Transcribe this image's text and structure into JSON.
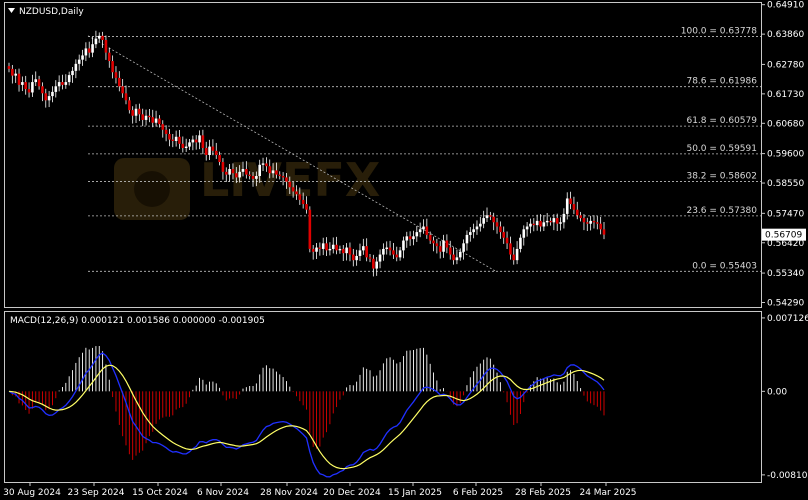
{
  "chart_data": [
    {
      "type": "candlestick",
      "symbol_label": "NZDUSD,Daily",
      "y_ticks": [
        "0.64910",
        "0.63860",
        "0.62780",
        "0.61730",
        "0.60680",
        "0.59600",
        "0.58550",
        "0.57470",
        "0.56420",
        "0.55340",
        "0.54290"
      ],
      "ylim": [
        0.5413,
        0.6497
      ],
      "current_price": "0.56709",
      "x_ticks": [
        "30 Aug 2024",
        "23 Sep 2024",
        "15 Oct 2024",
        "6 Nov 2024",
        "28 Nov 2024",
        "20 Dec 2024",
        "15 Jan 2025",
        "6 Feb 2025",
        "28 Feb 2025",
        "24 Mar 2025"
      ],
      "fibonacci": [
        {
          "label": "100.0 = 0.63778",
          "value": 0.63778
        },
        {
          "label": "78.6 = 0.61986",
          "value": 0.61986
        },
        {
          "label": "61.8 = 0.60579",
          "value": 0.60579
        },
        {
          "label": "50.0 = 0.59591",
          "value": 0.59591
        },
        {
          "label": "38.2 = 0.58602",
          "value": 0.58602
        },
        {
          "label": "23.6 = 0.57380",
          "value": 0.5738
        },
        {
          "label": "0.0 = 0.55403",
          "value": 0.55403
        }
      ],
      "close": [
        0.6262,
        0.6238,
        0.6245,
        0.6205,
        0.6215,
        0.619,
        0.6178,
        0.6215,
        0.6225,
        0.62,
        0.6175,
        0.615,
        0.6165,
        0.618,
        0.62,
        0.6215,
        0.6205,
        0.6215,
        0.624,
        0.6255,
        0.628,
        0.6295,
        0.631,
        0.6335,
        0.632,
        0.635,
        0.637,
        0.638,
        0.6365,
        0.632,
        0.629,
        0.625,
        0.623,
        0.62,
        0.6175,
        0.615,
        0.6115,
        0.6095,
        0.612,
        0.61,
        0.608,
        0.6095,
        0.609,
        0.607,
        0.6085,
        0.6065,
        0.6045,
        0.603,
        0.601,
        0.6005,
        0.602,
        0.5995,
        0.598,
        0.5985,
        0.6,
        0.601,
        0.6,
        0.6025,
        0.598,
        0.5955,
        0.5985,
        0.597,
        0.5955,
        0.593,
        0.5895,
        0.5885,
        0.5905,
        0.589,
        0.5875,
        0.5895,
        0.5905,
        0.5885,
        0.588,
        0.587,
        0.588,
        0.592,
        0.5925,
        0.5915,
        0.589,
        0.59,
        0.5885,
        0.588,
        0.5875,
        0.586,
        0.584,
        0.5825,
        0.5815,
        0.5795,
        0.578,
        0.576,
        0.562,
        0.561,
        0.5625,
        0.562,
        0.564,
        0.5615,
        0.562,
        0.5635,
        0.5615,
        0.562,
        0.5605,
        0.5625,
        0.56,
        0.558,
        0.5595,
        0.5615,
        0.563,
        0.559,
        0.5585,
        0.555,
        0.5575,
        0.56,
        0.562,
        0.5625,
        0.5615,
        0.56,
        0.559,
        0.5615,
        0.565,
        0.5665,
        0.5655,
        0.5665,
        0.568,
        0.569,
        0.57,
        0.567,
        0.565,
        0.564,
        0.563,
        0.561,
        0.565,
        0.5625,
        0.56,
        0.558,
        0.559,
        0.561,
        0.564,
        0.567,
        0.568,
        0.569,
        0.57,
        0.571,
        0.573,
        0.574,
        0.5735,
        0.5715,
        0.57,
        0.568,
        0.566,
        0.564,
        0.56,
        0.558,
        0.562,
        0.566,
        0.569,
        0.57,
        0.571,
        0.5705,
        0.572,
        0.57,
        0.5715,
        0.572,
        0.5715,
        0.573,
        0.571,
        0.5715,
        0.5745,
        0.58,
        0.578,
        0.576,
        0.574,
        0.573,
        0.5715,
        0.571,
        0.572,
        0.5715,
        0.571,
        0.569,
        0.5671
      ],
      "macd_label": "MACD(12,26,9) 0.000121 0.001586 0.000000 -0.001905",
      "macd_y_ticks": [
        "0.007126",
        "0.00",
        "-0.008109"
      ],
      "macd_ylim": [
        -0.0088,
        0.0077
      ]
    }
  ]
}
